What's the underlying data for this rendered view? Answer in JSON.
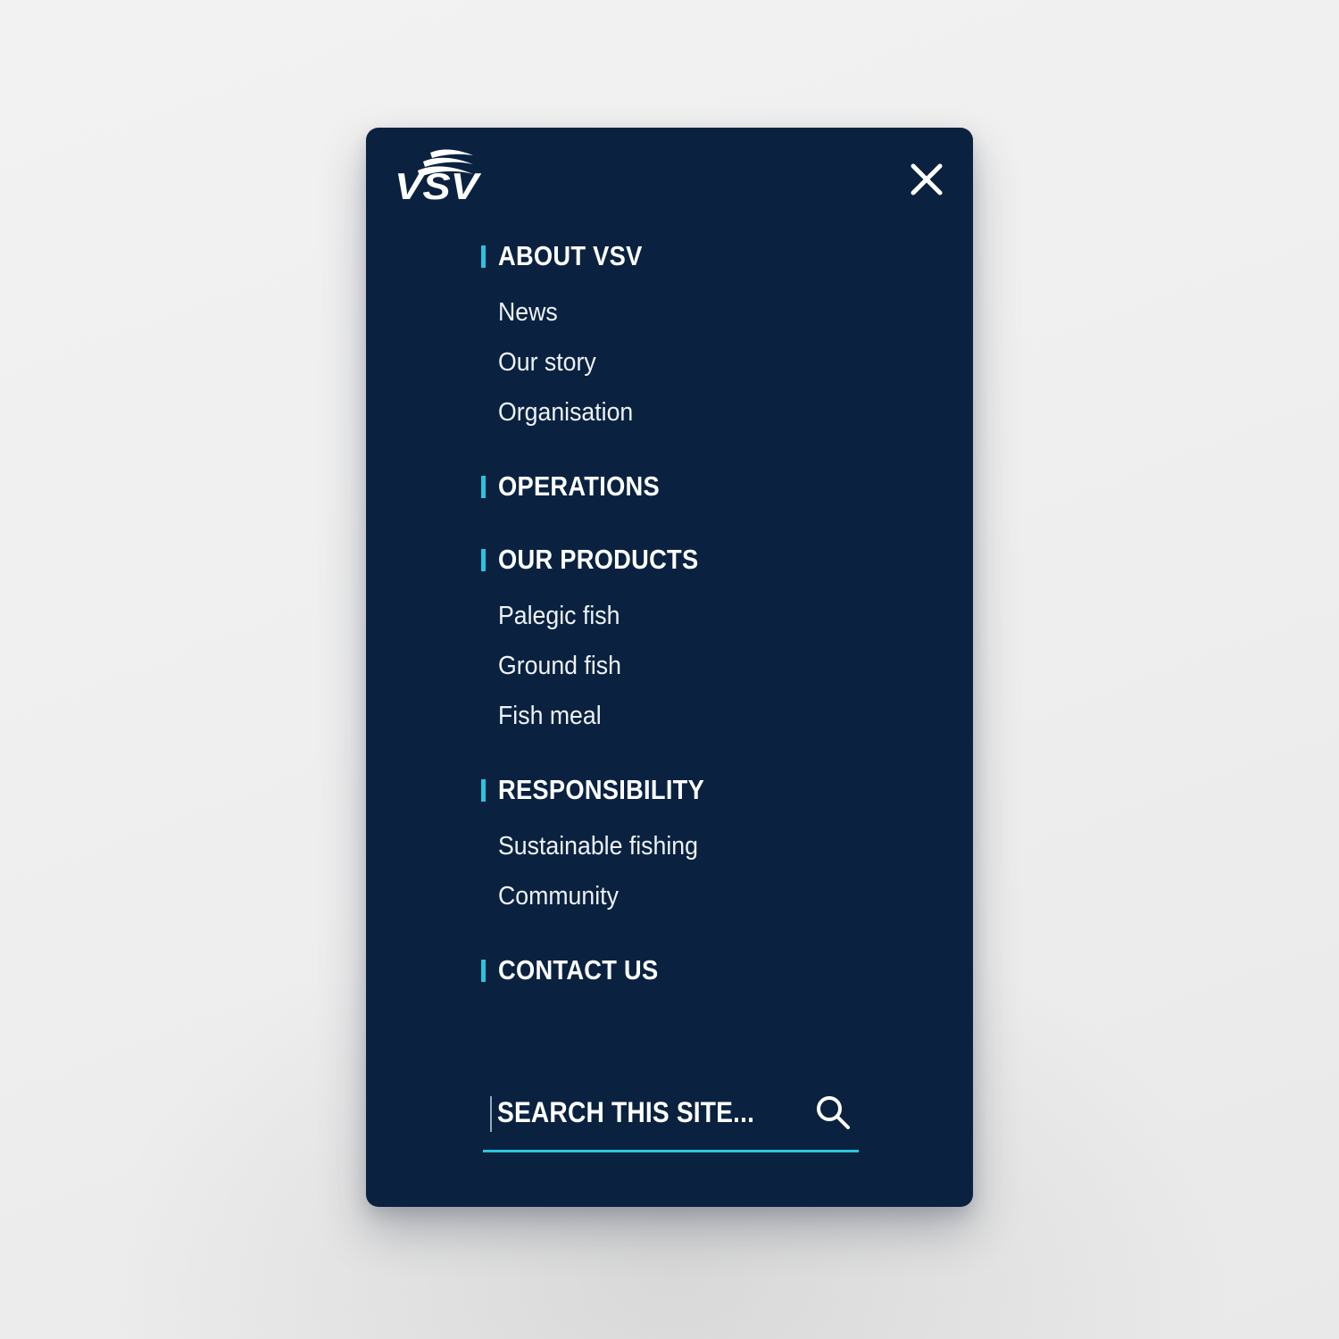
{
  "theme": {
    "panel_bg": "#0a2240",
    "page_bg": "#f0f0f0",
    "accent": "#2bc4dc",
    "text": "#ffffff"
  },
  "header": {
    "logo_text": "VSV",
    "logo_icon": "vsv-wave-logo",
    "close_icon": "close-icon",
    "close_label": "Close menu"
  },
  "nav": {
    "sections": [
      {
        "label": "ABOUT VSV",
        "items": [
          {
            "label": "News"
          },
          {
            "label": "Our story"
          },
          {
            "label": "Organisation"
          }
        ]
      },
      {
        "label": "OPERATIONS",
        "items": []
      },
      {
        "label": "OUR PRODUCTS",
        "items": [
          {
            "label": "Palegic fish"
          },
          {
            "label": "Ground fish"
          },
          {
            "label": "Fish meal"
          }
        ]
      },
      {
        "label": "RESPONSIBILITY",
        "items": [
          {
            "label": "Sustainable fishing"
          },
          {
            "label": "Community"
          }
        ]
      },
      {
        "label": "CONTACT US",
        "items": []
      }
    ]
  },
  "search": {
    "value": "",
    "placeholder": "SEARCH THIS SITE...",
    "icon": "search-icon"
  }
}
